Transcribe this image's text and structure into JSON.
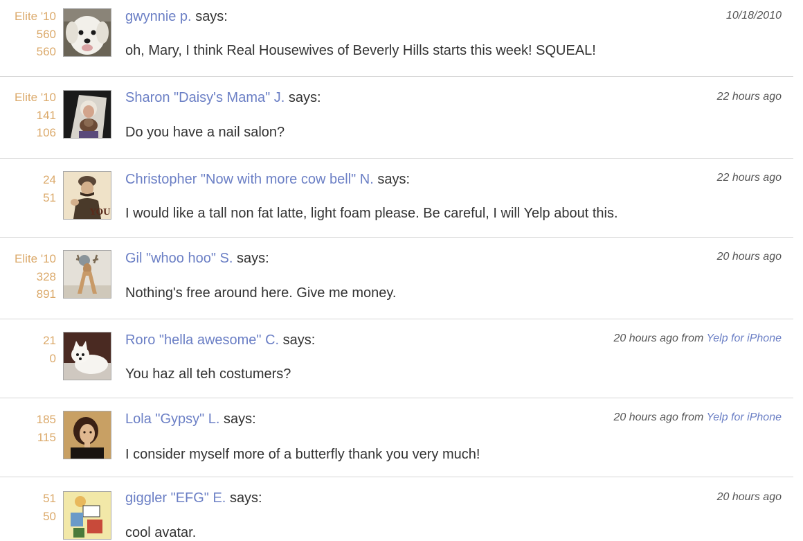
{
  "comments": [
    {
      "stats": [
        "Elite '10",
        "560",
        "560"
      ],
      "author": "gwynnie p.",
      "says": "says:",
      "time": "10/18/2010",
      "source_prefix": "",
      "source": "",
      "message": "oh, Mary, I think Real Housewives of Beverly Hills starts this week! SQUEAL!",
      "avatar": "white-dog-avatar"
    },
    {
      "stats": [
        "Elite '10",
        "141",
        "106"
      ],
      "author": "Sharon \"Daisy's Mama\" J.",
      "says": "says:",
      "time": "22 hours ago",
      "source_prefix": "",
      "source": "",
      "message": "Do you have a nail salon?",
      "avatar": "woman-with-dog-avatar"
    },
    {
      "stats": [
        "24",
        "51"
      ],
      "author": "Christopher \"Now with more cow bell\" N.",
      "says": "says:",
      "time": "22 hours ago",
      "source_prefix": "",
      "source": "",
      "message": "I would like a tall non fat latte, light foam please. Be careful, I will Yelp about this.",
      "avatar": "you-poster-avatar",
      "avatar_text": "YOU"
    },
    {
      "stats": [
        "Elite '10",
        "328",
        "891"
      ],
      "author": "Gil \"whoo hoo\" S.",
      "says": "says:",
      "time": "20 hours ago",
      "source_prefix": "",
      "source": "",
      "message": "Nothing's free around here.  Give me money.",
      "avatar": "deer-statue-avatar"
    },
    {
      "stats": [
        "21",
        "0"
      ],
      "author": "Roro \"hella awesome\" C.",
      "says": "says:",
      "time": "20 hours ago",
      "source_prefix": " from ",
      "source": "Yelp for iPhone",
      "message": "You haz all teh costumers?",
      "avatar": "white-dog-lying-avatar"
    },
    {
      "stats": [
        "185",
        "115"
      ],
      "author": "Lola \"Gypsy\" L.",
      "says": "says:",
      "time": "20 hours ago",
      "source_prefix": " from ",
      "source": "Yelp for iPhone",
      "message": "I consider myself more of a butterfly thank you very much!",
      "avatar": "woman-portrait-avatar"
    },
    {
      "stats": [
        "51",
        "50"
      ],
      "author": "giggler \"EFG\" E.",
      "says": "says:",
      "time": "20 hours ago",
      "source_prefix": "",
      "source": "",
      "message": "cool avatar.",
      "avatar": "cartoon-avatar"
    }
  ]
}
